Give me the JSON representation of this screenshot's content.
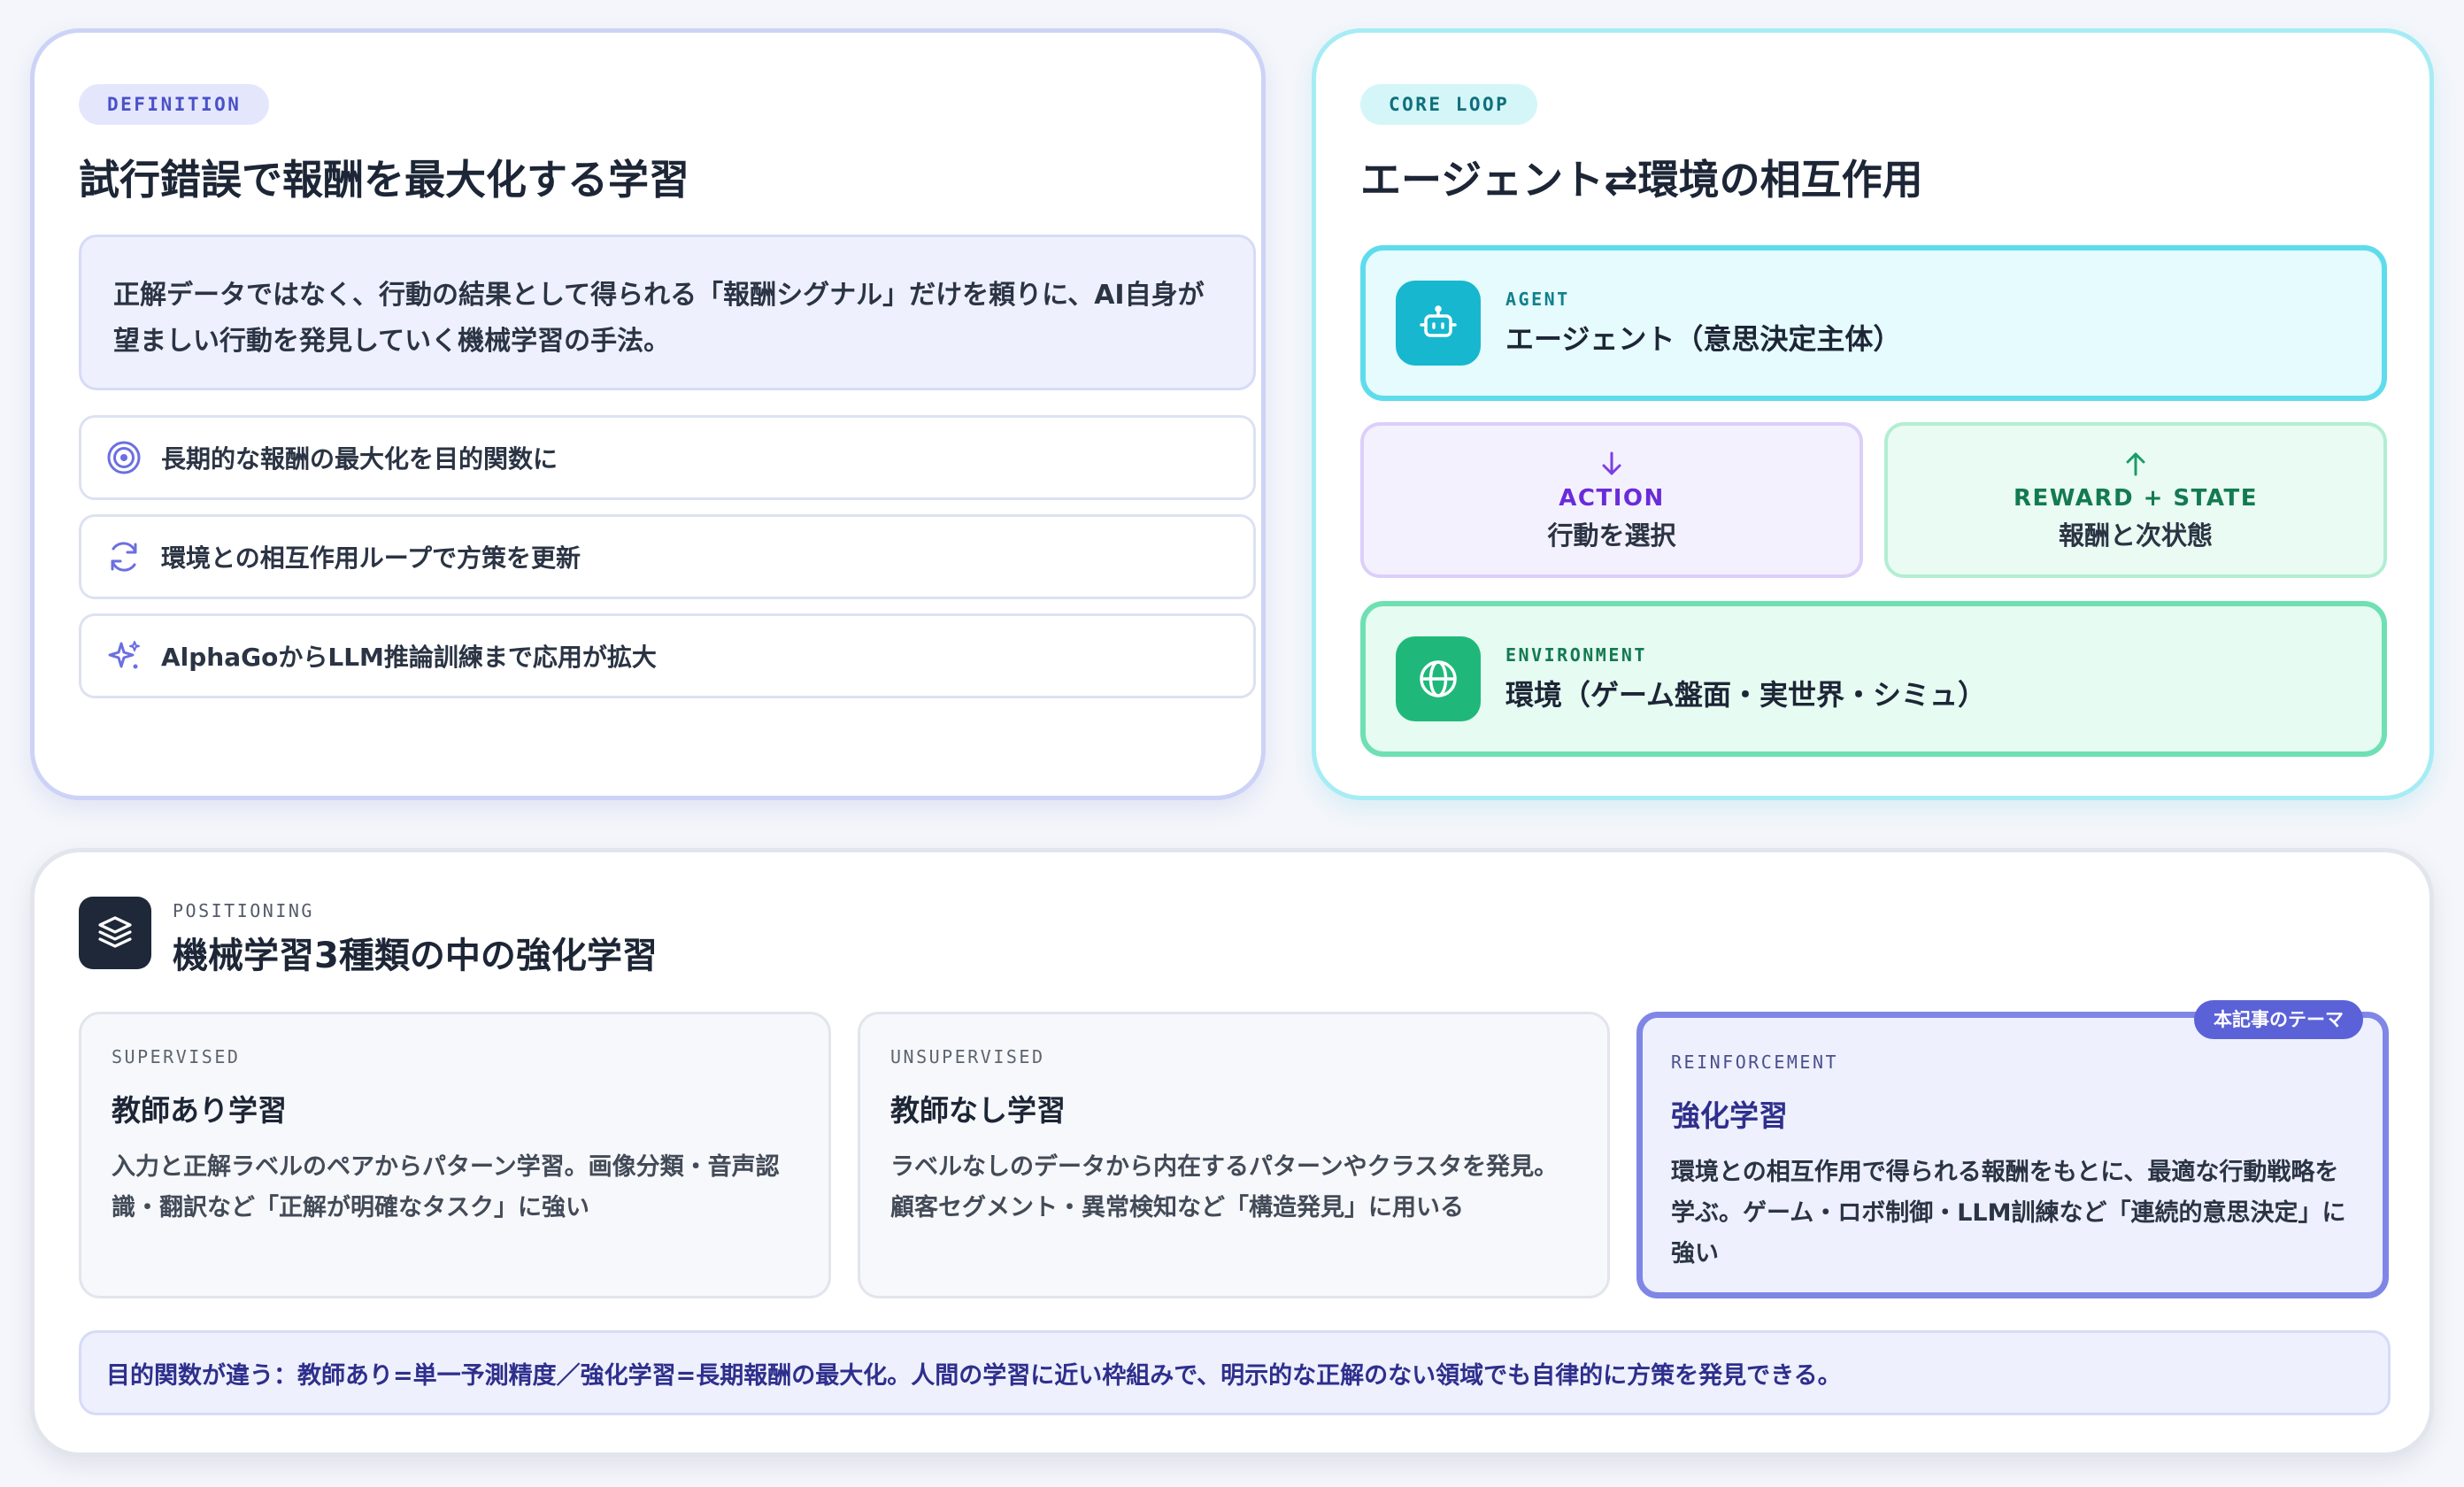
{
  "definition": {
    "pill": "DEFINITION",
    "title": "試行錯誤で報酬を最大化する学習",
    "description": "正解データではなく、行動の結果として得られる「報酬シグナル」だけを頼りに、AI自身が望ましい行動を発見していく機械学習の手法。",
    "features": [
      {
        "icon": "target-icon",
        "text": "長期的な報酬の最大化を目的関数に"
      },
      {
        "icon": "refresh-icon",
        "text": "環境との相互作用ループで方策を更新"
      },
      {
        "icon": "sparkle-icon",
        "text": "AlphaGoからLLM推論訓練まで応用が拡大"
      }
    ]
  },
  "core_loop": {
    "pill": "CORE LOOP",
    "title": "エージェント⇄環境の相互作用",
    "agent": {
      "sub": "AGENT",
      "label": "エージェント（意思決定主体）",
      "icon": "robot-icon"
    },
    "action": {
      "name": "ACTION",
      "desc": "行動を選択",
      "icon": "arrow-down-icon"
    },
    "reward": {
      "name": "REWARD + STATE",
      "desc": "報酬と次状態",
      "icon": "arrow-up-icon"
    },
    "environment": {
      "sub": "ENVIRONMENT",
      "label": "環境（ゲーム盤面・実世界・シミュ）",
      "icon": "globe-icon"
    }
  },
  "positioning": {
    "sub": "POSITIONING",
    "title": "機械学習3種類の中の強化学習",
    "icon": "layers-icon",
    "types": [
      {
        "sub": "SUPERVISED",
        "name": "教師あり学習",
        "desc": "入力と正解ラベルのペアからパターン学習。画像分類・音声認識・翻訳など「正解が明確なタスク」に強い"
      },
      {
        "sub": "UNSUPERVISED",
        "name": "教師なし学習",
        "desc": "ラベルなしのデータから内在するパターンやクラスタを発見。顧客セグメント・異常検知など「構造発見」に用いる"
      },
      {
        "sub": "REINFORCEMENT",
        "name": "強化学習",
        "desc": "環境との相互作用で得られる報酬をもとに、最適な行動戦略を学ぶ。ゲーム・ロボ制御・LLM訓練など「連続的意思決定」に強い",
        "badge": "本記事のテーマ"
      }
    ],
    "note": "目的関数が違う：教師あり=単一予測精度／強化学習=長期報酬の最大化。人間の学習に近い枠組みで、明示的な正解のない領域でも自律的に方策を発見できる。"
  },
  "colors": {
    "indigo": "#6b6fe0",
    "cyan": "#17b7cf",
    "green": "#1fb87a",
    "violet": "#7b3fe4",
    "dark": "#1e2838"
  }
}
